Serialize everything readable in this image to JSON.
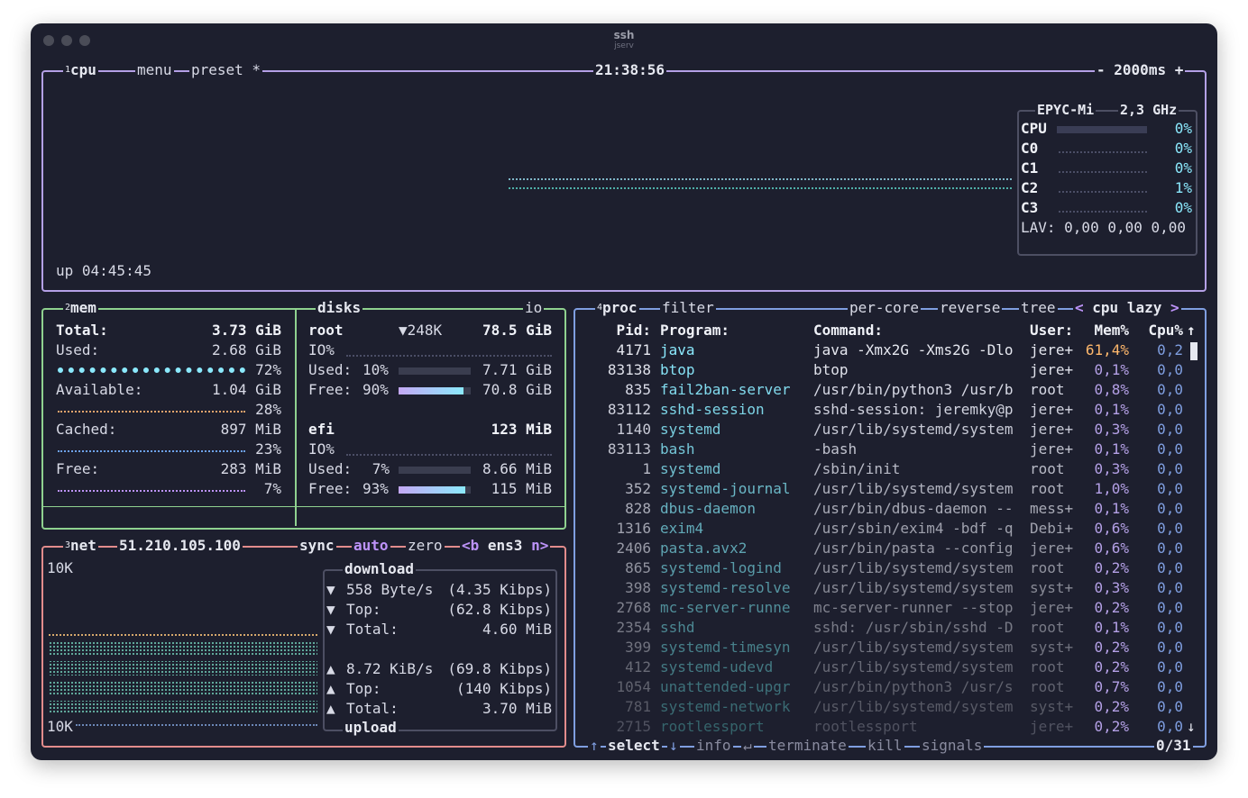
{
  "window": {
    "title": "ssh",
    "subtitle": "jserv"
  },
  "cpu": {
    "box_num": "1",
    "label": "cpu",
    "menu": "menu",
    "preset": "preset *",
    "clock": "21:38:56",
    "interval_minus": "-",
    "interval": "2000ms",
    "interval_plus": "+",
    "model": "EPYC-Mi",
    "freq": "2,3 GHz",
    "uptime": "up 04:45:45",
    "cores": [
      {
        "name": "CPU",
        "pct": "0%"
      },
      {
        "name": "C0",
        "pct": "0%"
      },
      {
        "name": "C1",
        "pct": "0%"
      },
      {
        "name": "C2",
        "pct": "1%"
      },
      {
        "name": "C3",
        "pct": "0%"
      }
    ],
    "load_avg": "LAV: 0,00 0,00 0,00"
  },
  "mem": {
    "box_num": "2",
    "label": "mem",
    "rows": [
      {
        "label": "Total:",
        "value": "3.73 GiB"
      },
      {
        "label": "Used:",
        "value": "2.68 GiB",
        "pct": "72%"
      },
      {
        "label": "Available:",
        "value": "1.04 GiB",
        "pct": "28%"
      },
      {
        "label": "Cached:",
        "value": "897 MiB",
        "pct": "23%"
      },
      {
        "label": "Free:",
        "value": "283 MiB",
        "pct": "7%"
      }
    ],
    "colors": {
      "used": "#8be9fd",
      "available": "#ffb86c",
      "cached": "#6fa3ef",
      "free": "#bd93f9"
    }
  },
  "disks": {
    "label": "disks",
    "io_label": "io",
    "root": {
      "name": "root",
      "io_rate": "▼248K",
      "size": "78.5 GiB",
      "io": "IO%",
      "used_label": "Used:",
      "used_pct": "10%",
      "used": "7.71 GiB",
      "free_label": "Free:",
      "free_pct": "90%",
      "free": "70.8 GiB",
      "free_fill": 0.9
    },
    "efi": {
      "name": "efi",
      "size": "123 MiB",
      "io": "IO%",
      "used_label": "Used:",
      "used_pct": "7%",
      "used": "8.66 MiB",
      "free_label": "Free:",
      "free_pct": "93%",
      "free": "115 MiB",
      "free_fill": 0.93
    }
  },
  "net": {
    "box_num": "3",
    "label": "net",
    "ip": "51.210.105.100",
    "sync": "sync",
    "auto": "auto",
    "zero": "zero",
    "prev": "<b",
    "iface": "ens3",
    "next": "n>",
    "scale_top": "10K",
    "scale_bottom": "10K",
    "download_title": "download",
    "upload_title": "upload",
    "download": {
      "rate_arrow": "▼",
      "rate": "558 Byte/s",
      "rate_bits": "(4.35 Kibps)",
      "top_label": "Top:",
      "top": "(62.8 Kibps)",
      "total_label": "Total:",
      "total": "4.60 MiB"
    },
    "upload": {
      "rate_arrow": "▲",
      "rate": "8.72 KiB/s",
      "rate_bits": "(69.8 Kibps)",
      "top_label": "Top:",
      "top": "(140 Kibps)",
      "total_label": "Total:",
      "total": "3.70 MiB"
    }
  },
  "proc": {
    "box_num": "4",
    "label": "proc",
    "filter": "filter",
    "per_core": "per-core",
    "reverse": "reverse",
    "tree": "tree",
    "sort_prev": "<",
    "sort": "cpu lazy",
    "sort_next": ">",
    "headers": {
      "pid": "Pid:",
      "program": "Program:",
      "command": "Command:",
      "user": "User:",
      "mem": "Mem%",
      "cpu": "Cpu%",
      "sort_arrow": "↑"
    },
    "rows": [
      {
        "pid": "4171",
        "program": "java",
        "command": "java -Xmx2G -Xms2G -Dlo",
        "user": "jere+",
        "mem": "61,4%",
        "cpu": "0,2"
      },
      {
        "pid": "83138",
        "program": "btop",
        "command": "btop",
        "user": "jere+",
        "mem": "0,1%",
        "cpu": "0,0"
      },
      {
        "pid": "835",
        "program": "fail2ban-server",
        "command": "/usr/bin/python3 /usr/b",
        "user": "root",
        "mem": "0,8%",
        "cpu": "0,0"
      },
      {
        "pid": "83112",
        "program": "sshd-session",
        "command": "sshd-session: jeremky@p",
        "user": "jere+",
        "mem": "0,1%",
        "cpu": "0,0"
      },
      {
        "pid": "1140",
        "program": "systemd",
        "command": "/usr/lib/systemd/system",
        "user": "jere+",
        "mem": "0,3%",
        "cpu": "0,0"
      },
      {
        "pid": "83113",
        "program": "bash",
        "command": "-bash",
        "user": "jere+",
        "mem": "0,1%",
        "cpu": "0,0"
      },
      {
        "pid": "1",
        "program": "systemd",
        "command": "/sbin/init",
        "user": "root",
        "mem": "0,3%",
        "cpu": "0,0"
      },
      {
        "pid": "352",
        "program": "systemd-journal",
        "command": "/usr/lib/systemd/system",
        "user": "root",
        "mem": "1,0%",
        "cpu": "0,0"
      },
      {
        "pid": "828",
        "program": "dbus-daemon",
        "command": "/usr/bin/dbus-daemon --",
        "user": "mess+",
        "mem": "0,1%",
        "cpu": "0,0"
      },
      {
        "pid": "1316",
        "program": "exim4",
        "command": "/usr/sbin/exim4 -bdf -q",
        "user": "Debi+",
        "mem": "0,6%",
        "cpu": "0,0"
      },
      {
        "pid": "2406",
        "program": "pasta.avx2",
        "command": "/usr/bin/pasta --config",
        "user": "jere+",
        "mem": "0,6%",
        "cpu": "0,0"
      },
      {
        "pid": "865",
        "program": "systemd-logind",
        "command": "/usr/lib/systemd/system",
        "user": "root",
        "mem": "0,2%",
        "cpu": "0,0"
      },
      {
        "pid": "398",
        "program": "systemd-resolve",
        "command": "/usr/lib/systemd/system",
        "user": "syst+",
        "mem": "0,3%",
        "cpu": "0,0"
      },
      {
        "pid": "2768",
        "program": "mc-server-runne",
        "command": "mc-server-runner --stop",
        "user": "jere+",
        "mem": "0,2%",
        "cpu": "0,0"
      },
      {
        "pid": "2354",
        "program": "sshd",
        "command": "sshd: /usr/sbin/sshd -D",
        "user": "root",
        "mem": "0,1%",
        "cpu": "0,0"
      },
      {
        "pid": "399",
        "program": "systemd-timesyn",
        "command": "/usr/lib/systemd/system",
        "user": "syst+",
        "mem": "0,2%",
        "cpu": "0,0"
      },
      {
        "pid": "412",
        "program": "systemd-udevd",
        "command": "/usr/lib/systemd/system",
        "user": "root",
        "mem": "0,2%",
        "cpu": "0,0"
      },
      {
        "pid": "1054",
        "program": "unattended-upgr",
        "command": "/usr/bin/python3 /usr/s",
        "user": "root",
        "mem": "0,7%",
        "cpu": "0,0"
      },
      {
        "pid": "781",
        "program": "systemd-network",
        "command": "/usr/lib/systemd/system",
        "user": "syst+",
        "mem": "0,2%",
        "cpu": "0,0"
      },
      {
        "pid": "2715",
        "program": "rootlessport",
        "command": "rootlessport",
        "user": "jere+",
        "mem": "0,2%",
        "cpu": "0,0"
      }
    ],
    "footer": {
      "up_arrow": "↑",
      "select": "select",
      "down_arrow": "↓",
      "info": "info",
      "enter_icon": "↵",
      "terminate": "terminate",
      "kill": "kill",
      "signals": "signals",
      "count": "0/31"
    },
    "scroll_down_arrow": "↓"
  },
  "colors": {
    "cpu_box": "#b4a0e6",
    "mem_box": "#8fd18f",
    "net_box": "#e28c8c",
    "proc_box": "#7f9ee0",
    "program": "#8be9fd",
    "selected_mem": "#ffb86c",
    "accent": "#bd93f9"
  }
}
